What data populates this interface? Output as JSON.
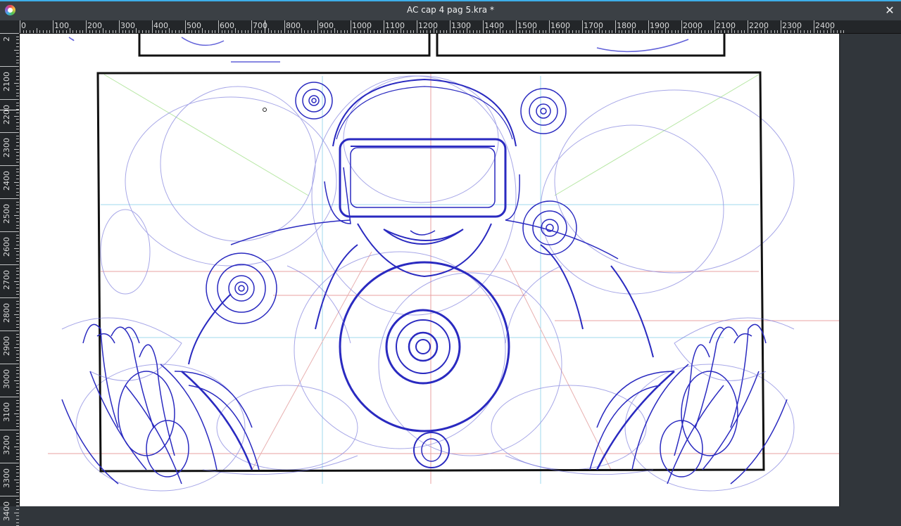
{
  "app": {
    "window_title": "AC cap 4 pag 5.kra *",
    "close_symbol": "✕",
    "icon": "krita-app-icon"
  },
  "rulers": {
    "unit": "px",
    "horizontal_labels": [
      "0",
      "100",
      "200",
      "300",
      "400",
      "500",
      "600",
      "700",
      "800",
      "900",
      "1000",
      "1100",
      "1200",
      "1300",
      "1400",
      "1500",
      "1600",
      "1700",
      "1800",
      "1900",
      "2000",
      "2100",
      "2200",
      "2300",
      "2400"
    ],
    "vertical_labels": [
      "2",
      "2100",
      "2200",
      "2300",
      "2400",
      "2500",
      "2600",
      "2700",
      "2800",
      "2900",
      "3000",
      "3100",
      "3200",
      "3300",
      "3400"
    ]
  },
  "colors": {
    "sketch_blue": "#2a2ac0",
    "sketch_light": "#8a8ae0",
    "panel_border": "#111111",
    "guide_red": "#e8a0a0",
    "guide_cyan": "#9fd8ee",
    "guide_green": "#b7e7a4"
  },
  "canvas": {
    "content": "sketch-artwork"
  }
}
